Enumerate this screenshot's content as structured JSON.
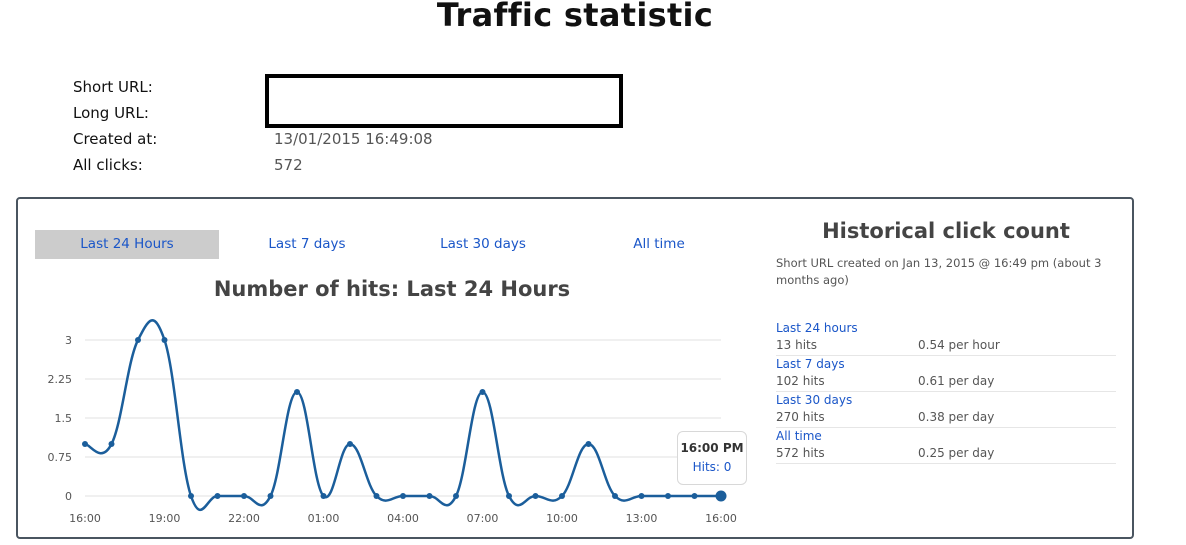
{
  "page": {
    "title": "Traffic statistic"
  },
  "info": {
    "short_url_label": "Short URL:",
    "long_url_label": "Long URL:",
    "created_label": "Created at:",
    "created_value": "13/01/2015 16:49:08",
    "clicks_label": "All clicks:",
    "clicks_value": "572"
  },
  "tabs": [
    {
      "label": "Last 24 Hours",
      "active": true
    },
    {
      "label": "Last 7 days",
      "active": false
    },
    {
      "label": "Last 30 days",
      "active": false
    },
    {
      "label": "All time",
      "active": false
    }
  ],
  "chart_data": {
    "type": "line",
    "title": "Number of hits: Last 24 Hours",
    "x": [
      "16:00",
      "17:00",
      "18:00",
      "19:00",
      "20:00",
      "21:00",
      "22:00",
      "23:00",
      "00:00",
      "01:00",
      "02:00",
      "03:00",
      "04:00",
      "05:00",
      "06:00",
      "07:00",
      "08:00",
      "09:00",
      "10:00",
      "11:00",
      "12:00",
      "13:00",
      "14:00",
      "15:00",
      "16:00"
    ],
    "x_tick_labels": [
      "16:00",
      "19:00",
      "22:00",
      "01:00",
      "04:00",
      "07:00",
      "10:00",
      "13:00",
      "16:00"
    ],
    "series": [
      {
        "values": [
          1,
          1,
          3,
          3,
          0,
          0,
          0,
          0,
          2,
          0,
          1,
          0,
          0,
          0,
          0,
          2,
          0,
          0,
          0,
          1,
          0,
          0,
          0,
          0,
          0
        ]
      }
    ],
    "y_ticks": [
      "0",
      "0.75",
      "1.5",
      "2.25",
      "3"
    ],
    "ylim": [
      0,
      3
    ],
    "grid": true,
    "color": "#1b5e9b"
  },
  "tooltip": {
    "time": "16:00 PM",
    "text": "Hits: 0"
  },
  "historical": {
    "title": "Historical click count",
    "description": "Short URL created on Jan 13, 2015 @ 16:49 pm (about 3 months ago)",
    "stats": [
      {
        "period": "Last 24 hours",
        "hits": "13 hits",
        "rate": "0.54 per hour"
      },
      {
        "period": "Last 7 days",
        "hits": "102 hits",
        "rate": "0.61 per day"
      },
      {
        "period": "Last 30 days",
        "hits": "270 hits",
        "rate": "0.38 per day"
      },
      {
        "period": "All time",
        "hits": "572 hits",
        "rate": "0.25 per day"
      }
    ]
  }
}
